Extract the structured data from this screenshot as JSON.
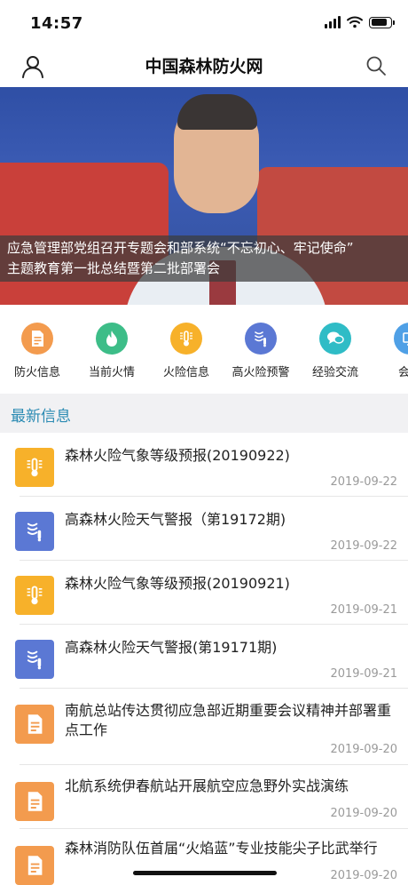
{
  "status_bar": {
    "time": "14:57"
  },
  "nav": {
    "title": "中国森林防火网",
    "user_icon": "user-icon",
    "search_icon": "search-icon"
  },
  "banner": {
    "caption_line1": "应急管理部党组召开专题会和部系统“不忘初心、牢记使命”",
    "caption_line2": "主题教育第一批总结暨第二批部署会"
  },
  "quick_nav": [
    {
      "label": "防火信息",
      "icon": "document-icon",
      "color": "#f39b4e"
    },
    {
      "label": "当前火情",
      "icon": "flame-icon",
      "color": "#3dbd88"
    },
    {
      "label": "火险信息",
      "icon": "thermometer-icon",
      "color": "#f7b12a"
    },
    {
      "label": "高火险预警",
      "icon": "wind-warning-icon",
      "color": "#5b78d4"
    },
    {
      "label": "经验交流",
      "icon": "chat-icon",
      "color": "#2fbcc6"
    },
    {
      "label": "会议",
      "icon": "meeting-icon",
      "color": "#4fa0e6"
    }
  ],
  "section": {
    "title": "最新信息"
  },
  "news": [
    {
      "title": "森林火险气象等级预报(20190922)",
      "date": "2019-09-22",
      "icon": "thermometer-icon",
      "color": "#f7b12a"
    },
    {
      "title": "高森林火险天气警报（第19172期)",
      "date": "2019-09-22",
      "icon": "wind-warning-icon",
      "color": "#5b78d4"
    },
    {
      "title": "森林火险气象等级预报(20190921)",
      "date": "2019-09-21",
      "icon": "thermometer-icon",
      "color": "#f7b12a"
    },
    {
      "title": "高森林火险天气警报(第19171期)",
      "date": "2019-09-21",
      "icon": "wind-warning-icon",
      "color": "#5b78d4"
    },
    {
      "title": "南航总站传达贯彻应急部近期重要会议精神并部署重点工作",
      "date": "2019-09-20",
      "icon": "document-icon",
      "color": "#f39b4e"
    },
    {
      "title": "北航系统伊春航站开展航空应急野外实战演练",
      "date": "2019-09-20",
      "icon": "document-icon",
      "color": "#f39b4e"
    },
    {
      "title": "森林消防队伍首届“火焰蓝”专业技能尖子比武举行",
      "date": "2019-09-20",
      "icon": "document-icon",
      "color": "#f39b4e"
    }
  ]
}
